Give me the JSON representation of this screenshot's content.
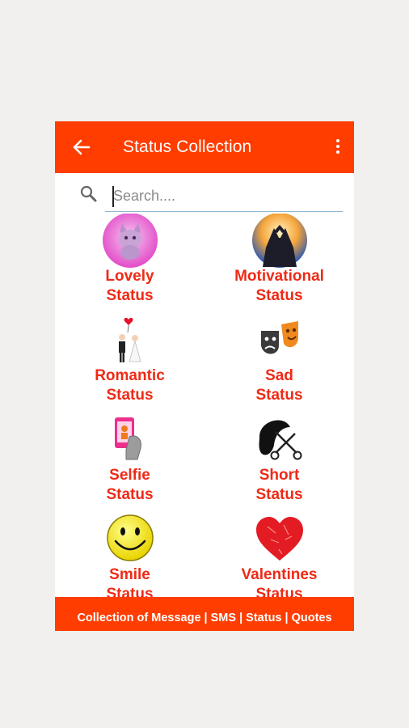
{
  "appbar": {
    "title": "Status Collection"
  },
  "search": {
    "placeholder": "Search...."
  },
  "categories": [
    {
      "line1": "Lovely",
      "line2": "Status",
      "icon": "pink-kitten-icon"
    },
    {
      "line1": "Motivational",
      "line2": "Status",
      "icon": "raised-hands-icon"
    },
    {
      "line1": "Romantic",
      "line2": "Status",
      "icon": "wedding-couple-icon"
    },
    {
      "line1": "Sad",
      "line2": "Status",
      "icon": "theater-masks-icon"
    },
    {
      "line1": "Selfie",
      "line2": "Status",
      "icon": "selfie-phone-icon"
    },
    {
      "line1": "Short",
      "line2": "Status",
      "icon": "scissors-hair-icon"
    },
    {
      "line1": "Smile",
      "line2": "Status",
      "icon": "smiley-face-icon"
    },
    {
      "line1": "Valentines",
      "line2": "Status",
      "icon": "heart-icon"
    }
  ],
  "footer": {
    "text": "Collection of Message | SMS | Status | Quotes"
  },
  "colors": {
    "accent": "#ff3d00",
    "label": "#ee2a16"
  }
}
